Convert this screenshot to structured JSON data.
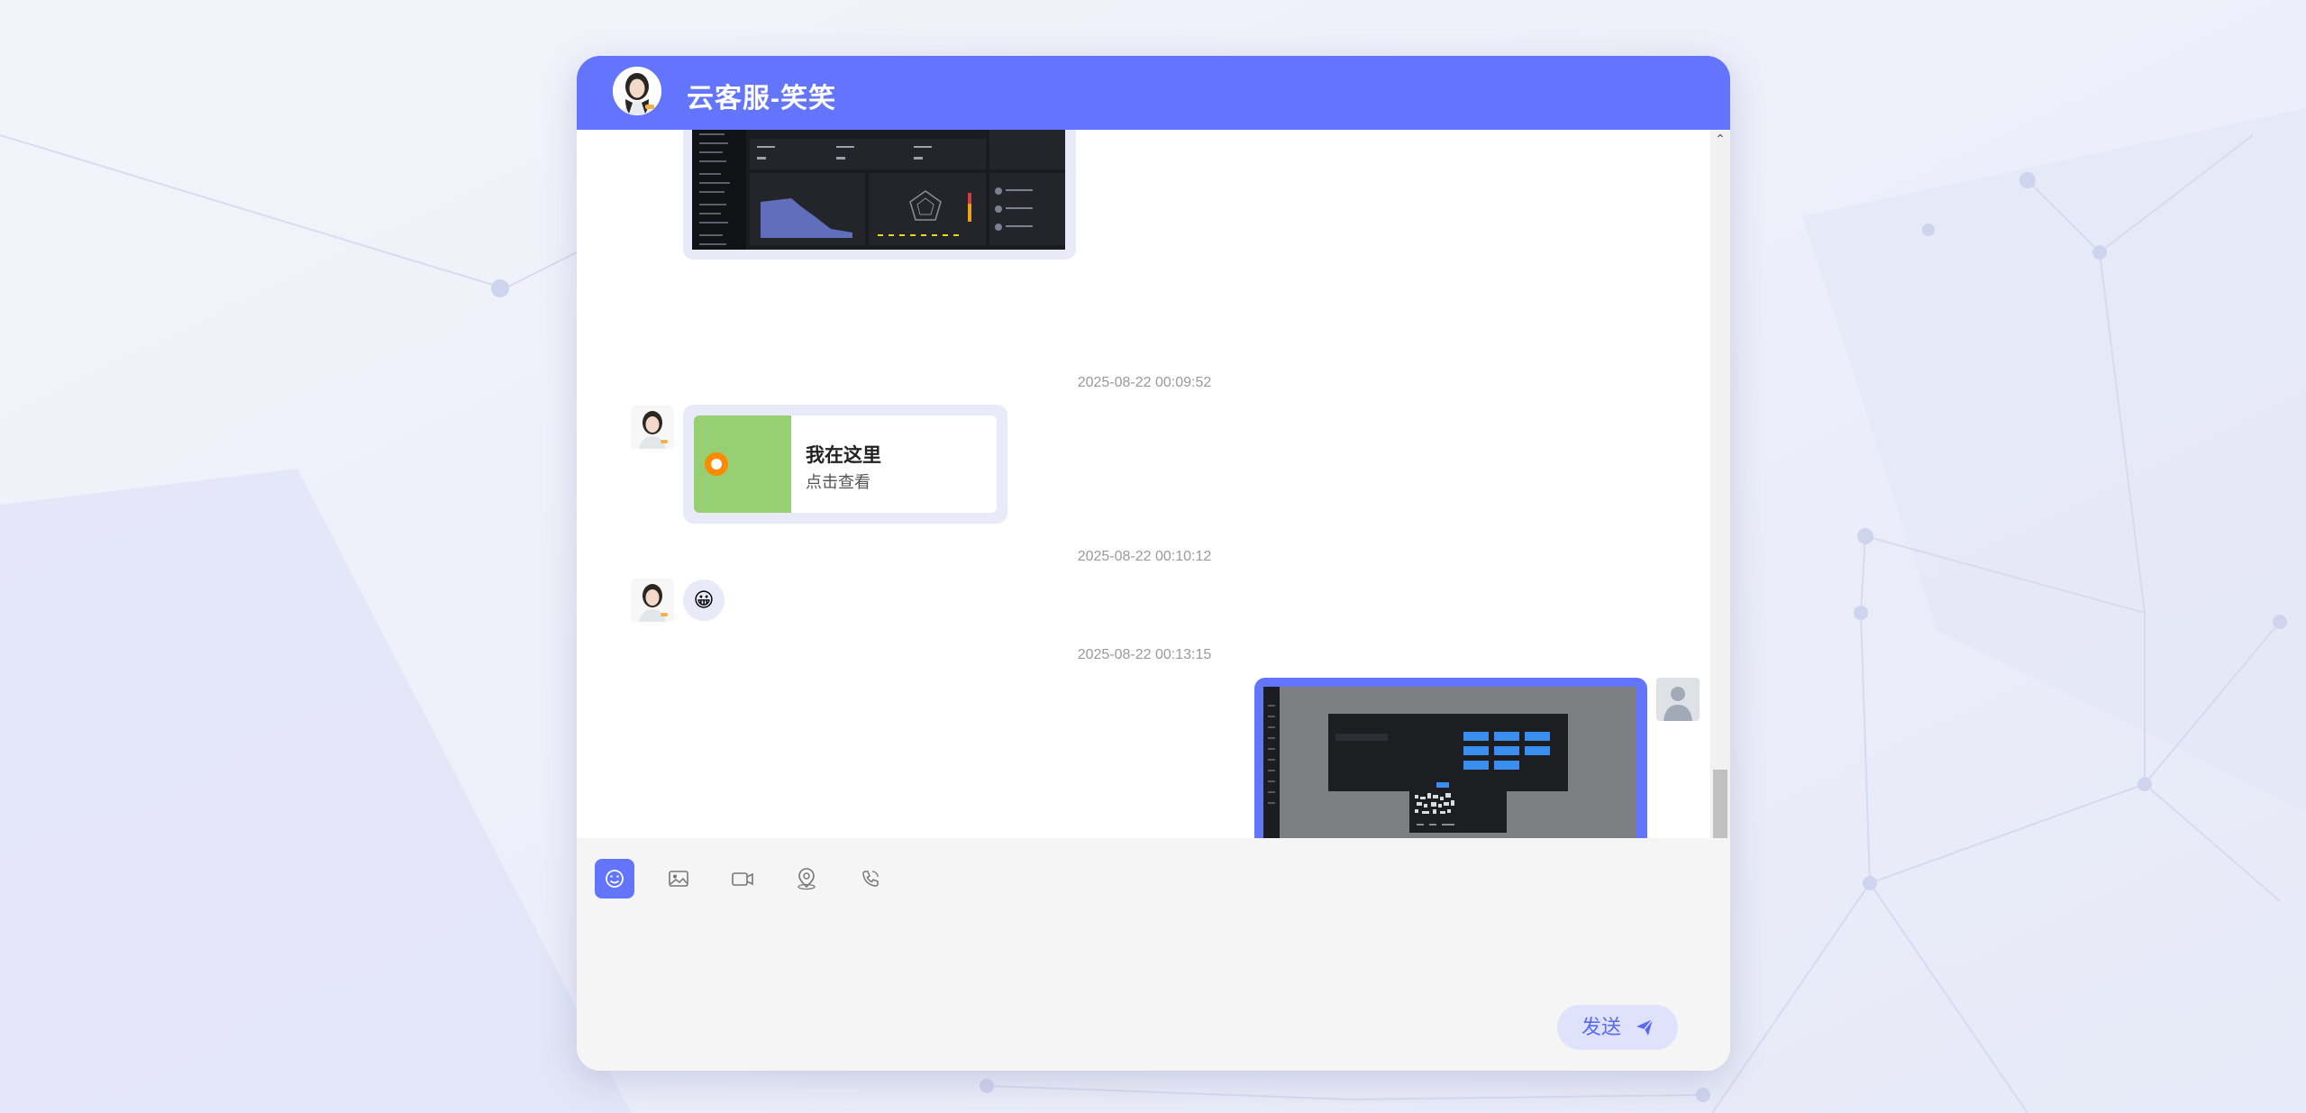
{
  "header": {
    "title": "云客服-笑笑",
    "avatar": "agent-avatar"
  },
  "messages": [
    {
      "type": "image",
      "side": "left",
      "description": "dashboard-screenshot-image"
    },
    {
      "timestamp": "2025-08-22 00:09:52"
    },
    {
      "type": "location",
      "side": "left",
      "title": "我在这里",
      "subtitle": "点击查看"
    },
    {
      "timestamp": "2025-08-22 00:10:12"
    },
    {
      "type": "emoji",
      "side": "left",
      "emoji": "😀"
    },
    {
      "timestamp": "2025-08-22 00:13:15"
    },
    {
      "type": "image",
      "side": "right",
      "description": "qr-dialog-screenshot-image"
    }
  ],
  "toolbar": {
    "items": [
      {
        "name": "emoji",
        "icon": "smile-icon"
      },
      {
        "name": "image",
        "icon": "image-icon"
      },
      {
        "name": "video",
        "icon": "video-icon"
      },
      {
        "name": "location",
        "icon": "location-icon"
      },
      {
        "name": "call",
        "icon": "phone-icon"
      }
    ]
  },
  "input": {
    "value": ""
  },
  "send_button": {
    "label": "发送",
    "icon": "send-icon"
  },
  "colors": {
    "primary": "#6475fd",
    "bubble": "#e8eaf8",
    "send_bg": "#dfe2fb"
  }
}
